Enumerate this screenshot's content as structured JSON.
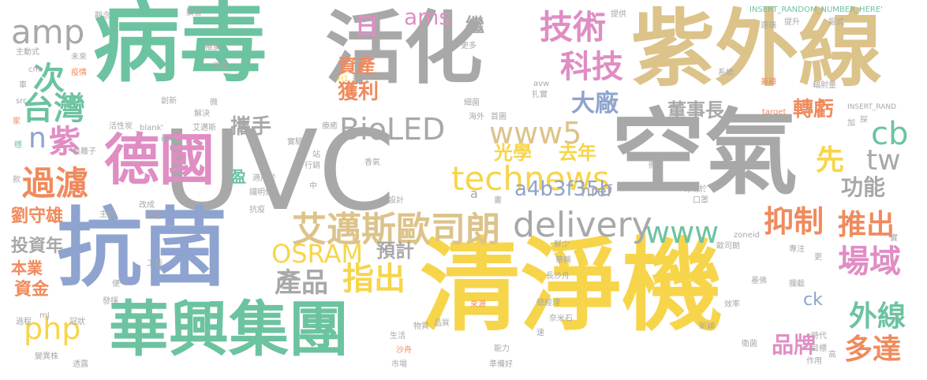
{
  "words": [
    {
      "id": "w1",
      "text": "病毒",
      "color": "#6cc3a0"
    },
    {
      "id": "w2",
      "text": "活化",
      "color": "#a8a8a8"
    },
    {
      "id": "w3",
      "text": "紫外線",
      "color": "#dcc38a"
    },
    {
      "id": "w4",
      "text": "UVC",
      "color": "#a8a8a8"
    },
    {
      "id": "w5",
      "text": "空氣",
      "color": "#a8a8a8"
    },
    {
      "id": "w6",
      "text": "抗菌",
      "color": "#8ea3cf"
    },
    {
      "id": "w7",
      "text": "清淨機",
      "color": "#f7d54a"
    },
    {
      "id": "w8",
      "text": "德國",
      "color": "#e08dc4"
    },
    {
      "id": "w9",
      "text": "華興集團",
      "color": "#6cc3a0"
    },
    {
      "id": "w10",
      "text": "艾邁斯歐司朗",
      "color": "#dcc38a"
    },
    {
      "id": "w11",
      "text": "delivery",
      "color": "#a8a8a8"
    },
    {
      "id": "w12",
      "text": "technews",
      "color": "#f7d54a"
    },
    {
      "id": "w13",
      "text": "BioLED",
      "color": "#a8a8a8"
    },
    {
      "id": "w14",
      "text": "www5",
      "color": "#dcc38a"
    },
    {
      "id": "w15",
      "text": "www",
      "color": "#6cc3a0"
    },
    {
      "id": "w16",
      "text": "技術",
      "color": "#e08dc4"
    },
    {
      "id": "w17",
      "text": "科技",
      "color": "#e08dc4"
    },
    {
      "id": "w18",
      "text": "大廠",
      "color": "#8ea3cf"
    },
    {
      "id": "w19",
      "text": "ams",
      "color": "#e08dc4"
    },
    {
      "id": "w20",
      "text": "amp",
      "color": "#a8a8a8"
    },
    {
      "id": "w21",
      "text": "台灣",
      "color": "#6cc3a0"
    },
    {
      "id": "w22",
      "text": "次",
      "color": "#6cc3a0"
    },
    {
      "id": "w23",
      "text": "n",
      "color": "#8ea3cf"
    },
    {
      "id": "w24",
      "text": "紫",
      "color": "#e08dc4"
    },
    {
      "id": "w25",
      "text": "過濾",
      "color": "#f08a5d"
    },
    {
      "id": "w26",
      "text": "劉守雄",
      "color": "#f08a5d"
    },
    {
      "id": "w27",
      "text": "投資年",
      "color": "#a8a8a8"
    },
    {
      "id": "w28",
      "text": "本業",
      "color": "#f08a5d"
    },
    {
      "id": "w29",
      "text": "資金",
      "color": "#f08a5d"
    },
    {
      "id": "w30",
      "text": "php",
      "color": "#f7d54a"
    },
    {
      "id": "w31",
      "text": "產品",
      "color": "#a8a8a8"
    },
    {
      "id": "w32",
      "text": "指出",
      "color": "#f7d54a"
    },
    {
      "id": "w33",
      "text": "OSRAM",
      "color": "#f7d54a"
    },
    {
      "id": "w34",
      "text": "預計",
      "color": "#a8a8a8"
    },
    {
      "id": "w35",
      "text": "光學",
      "color": "#f7d54a"
    },
    {
      "id": "w36",
      "text": "去年",
      "color": "#f7d54a"
    },
    {
      "id": "w37",
      "text": "a4b3f35b",
      "color": "#8ea3cf"
    },
    {
      "id": "w38",
      "text": "href",
      "color": "#a8a8a8"
    },
    {
      "id": "w39",
      "text": "攜手",
      "color": "#a8a8a8"
    },
    {
      "id": "w40",
      "text": "獲利",
      "color": "#f08a5d"
    },
    {
      "id": "w41",
      "text": "資產",
      "color": "#f08a5d"
    },
    {
      "id": "w42",
      "text": "日",
      "color": "#e08dc4"
    },
    {
      "id": "w43",
      "text": "董事長",
      "color": "#a8a8a8"
    },
    {
      "id": "w44",
      "text": "轉虧",
      "color": "#f08a5d"
    },
    {
      "id": "w45",
      "text": "cb",
      "color": "#6cc3a0"
    },
    {
      "id": "w46",
      "text": "tw",
      "color": "#a8a8a8"
    },
    {
      "id": "w47",
      "text": "先",
      "color": "#f7d54a"
    },
    {
      "id": "w48",
      "text": "功能",
      "color": "#a8a8a8"
    },
    {
      "id": "w49",
      "text": "抑制",
      "color": "#f08a5d"
    },
    {
      "id": "w50",
      "text": "推出",
      "color": "#f08a5d"
    },
    {
      "id": "w51",
      "text": "場域",
      "color": "#e08dc4"
    },
    {
      "id": "w52",
      "text": "外線",
      "color": "#6cc3a0"
    },
    {
      "id": "w53",
      "text": "多達",
      "color": "#f08a5d"
    },
    {
      "id": "w54",
      "text": "品牌",
      "color": "#e08dc4"
    },
    {
      "id": "w55",
      "text": "ck",
      "color": "#8ea3cf"
    },
    {
      "id": "w56",
      "text": "繼",
      "color": "#a8a8a8"
    },
    {
      "id": "w57",
      "text": "盈",
      "color": "#6cc3a0"
    },
    {
      "id": "w58",
      "text": "INSERT_RANDOM_NUMBER_HERE'",
      "color": "#6cc3a0"
    },
    {
      "id": "w59",
      "text": "INSERT_RAND",
      "color": "#a8a8a8"
    },
    {
      "id": "w60",
      "text": "主動式",
      "color": "#a8a8a8"
    },
    {
      "id": "w61",
      "text": "未來",
      "color": "#a8a8a8"
    },
    {
      "id": "w62",
      "text": "疫情",
      "color": "#f08a5d"
    },
    {
      "id": "w63",
      "text": "cm",
      "color": "#e08dc4"
    },
    {
      "id": "w64",
      "text": "src",
      "color": "#a8a8a8"
    },
    {
      "id": "w65",
      "text": "車",
      "color": "#a8a8a8"
    },
    {
      "id": "w66",
      "text": "家",
      "color": "#f08a5d"
    },
    {
      "id": "w67",
      "text": "穩",
      "color": "#6cc3a0"
    },
    {
      "id": "w68",
      "text": "負離子",
      "color": "#a8a8a8"
    },
    {
      "id": "w69",
      "text": "款",
      "color": "#a8a8a8"
    },
    {
      "id": "w70",
      "text": "觀念",
      "color": "#a8a8a8"
    },
    {
      "id": "w71",
      "text": "推廣",
      "color": "#a8a8a8"
    },
    {
      "id": "w72",
      "text": "消毒",
      "color": "#a8a8a8"
    },
    {
      "id": "w73",
      "text": "創新",
      "color": "#a8a8a8"
    },
    {
      "id": "w74",
      "text": "解決",
      "color": "#a8a8a8"
    },
    {
      "id": "w75",
      "text": "微",
      "color": "#a8a8a8"
    },
    {
      "id": "w76",
      "text": "艾邁斯",
      "color": "#a8a8a8"
    },
    {
      "id": "w77",
      "text": "活性炭",
      "color": "#a8a8a8"
    },
    {
      "id": "w78",
      "text": "img",
      "color": "#6cc3a0"
    },
    {
      "id": "w79",
      "text": "_blank'",
      "color": "#a8a8a8"
    },
    {
      "id": "w80",
      "text": "實驗證",
      "color": "#a8a8a8"
    },
    {
      "id": "w81",
      "text": "站",
      "color": "#a8a8a8"
    },
    {
      "id": "w82",
      "text": "適用於",
      "color": "#a8a8a8"
    },
    {
      "id": "w83",
      "text": "行銷",
      "color": "#a8a8a8"
    },
    {
      "id": "w84",
      "text": "鑼明佐",
      "color": "#a8a8a8"
    },
    {
      "id": "w85",
      "text": "抗疫",
      "color": "#a8a8a8"
    },
    {
      "id": "w86",
      "text": "改成",
      "color": "#a8a8a8"
    },
    {
      "id": "w87",
      "text": "包括",
      "color": "#a8a8a8"
    },
    {
      "id": "w88",
      "text": "主動",
      "color": "#a8a8a8"
    },
    {
      "id": "w89",
      "text": "工藝",
      "color": "#a8a8a8"
    },
    {
      "id": "w90",
      "text": "便",
      "color": "#a8a8a8"
    },
    {
      "id": "w91",
      "text": "發揮",
      "color": "#a8a8a8"
    },
    {
      "id": "w92",
      "text": "mJ",
      "color": "#a8a8a8"
    },
    {
      "id": "w93",
      "text": "冠狀",
      "color": "#a8a8a8"
    },
    {
      "id": "w94",
      "text": "過程",
      "color": "#a8a8a8"
    },
    {
      "id": "w95",
      "text": "變異株",
      "color": "#a8a8a8"
    },
    {
      "id": "w96",
      "text": "透露",
      "color": "#a8a8a8"
    },
    {
      "id": "w97",
      "text": "擴香",
      "color": "#a8a8a8"
    },
    {
      "id": "w98",
      "text": "更多",
      "color": "#a8a8a8"
    },
    {
      "id": "w99",
      "text": "H1",
      "color": "#f7d54a"
    },
    {
      "id": "w100",
      "text": "系列",
      "color": "#a8a8a8"
    },
    {
      "id": "w101",
      "text": "細菌",
      "color": "#a8a8a8"
    },
    {
      "id": "w102",
      "text": "療癒",
      "color": "#a8a8a8"
    },
    {
      "id": "w103",
      "text": "海外",
      "color": "#a8a8a8"
    },
    {
      "id": "w104",
      "text": "首圖",
      "color": "#a8a8a8"
    },
    {
      "id": "w105",
      "text": "香氣",
      "color": "#a8a8a8"
    },
    {
      "id": "w106",
      "text": "中",
      "color": "#a8a8a8"
    },
    {
      "id": "w107",
      "text": "設計",
      "color": "#a8a8a8"
    },
    {
      "id": "w108",
      "text": "a",
      "color": "#a8a8a8"
    },
    {
      "id": "w109",
      "text": "畫",
      "color": "#a8a8a8"
    },
    {
      "id": "w110",
      "text": "提供",
      "color": "#a8a8a8"
    },
    {
      "id": "w111",
      "text": "扎實",
      "color": "#a8a8a8"
    },
    {
      "id": "w112",
      "text": "avw",
      "color": "#a8a8a8"
    },
    {
      "id": "w113",
      "text": "粒",
      "color": "#a8a8a8"
    },
    {
      "id": "w114",
      "text": "系統",
      "color": "#a8a8a8"
    },
    {
      "id": "w115",
      "text": "兼顧",
      "color": "#f08a5d"
    },
    {
      "id": "w116",
      "text": "遠端",
      "color": "#a8a8a8"
    },
    {
      "id": "w117",
      "text": "提升",
      "color": "#a8a8a8"
    },
    {
      "id": "w118",
      "text": "掘式",
      "color": "#a8a8a8"
    },
    {
      "id": "w119",
      "text": "輻射量",
      "color": "#a8a8a8"
    },
    {
      "id": "w120",
      "text": "target",
      "color": "#f08a5d"
    },
    {
      "id": "w121",
      "text": "加",
      "color": "#a8a8a8"
    },
    {
      "id": "w122",
      "text": "探",
      "color": "#a8a8a8"
    },
    {
      "id": "w123",
      "text": "微",
      "color": "#a8a8a8"
    },
    {
      "id": "w124",
      "text": "有助於",
      "color": "#a8a8a8"
    },
    {
      "id": "w125",
      "text": "口罩",
      "color": "#a8a8a8"
    },
    {
      "id": "w126",
      "text": "zoneid",
      "color": "#a8a8a8"
    },
    {
      "id": "w127",
      "text": "歐司朗",
      "color": "#a8a8a8"
    },
    {
      "id": "w128",
      "text": "實",
      "color": "#a8a8a8"
    },
    {
      "id": "w129",
      "text": "專注",
      "color": "#a8a8a8"
    },
    {
      "id": "w130",
      "text": "更",
      "color": "#a8a8a8"
    },
    {
      "id": "w131",
      "text": "墨佛",
      "color": "#a8a8a8"
    },
    {
      "id": "w132",
      "text": "攔截",
      "color": "#a8a8a8"
    },
    {
      "id": "w133",
      "text": "效率",
      "color": "#a8a8a8"
    },
    {
      "id": "w134",
      "text": "新穎",
      "color": "#a8a8a8"
    },
    {
      "id": "w135",
      "text": "衛菌",
      "color": "#a8a8a8"
    },
    {
      "id": "w136",
      "text": "時代",
      "color": "#a8a8a8"
    },
    {
      "id": "w137",
      "text": "目標",
      "color": "#a8a8a8"
    },
    {
      "id": "w138",
      "text": "作用",
      "color": "#a8a8a8"
    },
    {
      "id": "w139",
      "text": "高",
      "color": "#a8a8a8"
    },
    {
      "id": "w140",
      "text": "鮮少",
      "color": "#a8a8a8"
    },
    {
      "id": "w141",
      "text": "華興",
      "color": "#a8a8a8"
    },
    {
      "id": "w142",
      "text": "長沙舟",
      "color": "#a8a8a8"
    },
    {
      "id": "w143",
      "text": "來源",
      "color": "#f08a5d"
    },
    {
      "id": "w144",
      "text": "總經理",
      "color": "#a8a8a8"
    },
    {
      "id": "w145",
      "text": "奈米石",
      "color": "#a8a8a8"
    },
    {
      "id": "w146",
      "text": "速",
      "color": "#a8a8a8"
    },
    {
      "id": "w147",
      "text": "物質",
      "color": "#a8a8a8"
    },
    {
      "id": "w148",
      "text": "品質",
      "color": "#a8a8a8"
    },
    {
      "id": "w149",
      "text": "生活",
      "color": "#a8a8a8"
    },
    {
      "id": "w150",
      "text": "沙舟",
      "color": "#f08a5d"
    },
    {
      "id": "w151",
      "text": "能力",
      "color": "#a8a8a8"
    },
    {
      "id": "w152",
      "text": "準備好",
      "color": "#a8a8a8"
    },
    {
      "id": "w153",
      "text": "市場",
      "color": "#a8a8a8"
    }
  ]
}
